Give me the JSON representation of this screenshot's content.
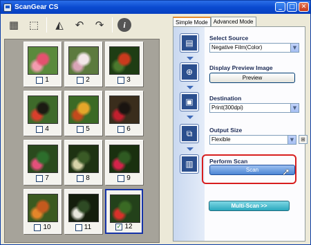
{
  "window": {
    "title": "ScanGear CS"
  },
  "toolbar": {
    "icons": [
      "thumbnail-view-icon",
      "crop-icon",
      "mirror-icon",
      "rotate-left-icon",
      "rotate-right-icon",
      "info-icon"
    ]
  },
  "thumbnails": [
    {
      "number": "1",
      "checked": false,
      "colors": [
        "#e4516f",
        "#f29bae",
        "#5a8a3c"
      ]
    },
    {
      "number": "2",
      "checked": false,
      "colors": [
        "#f3e7ea",
        "#d8a4b6",
        "#5c7a3e"
      ]
    },
    {
      "number": "3",
      "checked": false,
      "colors": [
        "#c93a1d",
        "#4b7a2e",
        "#1e3d14"
      ]
    },
    {
      "number": "4",
      "checked": false,
      "colors": [
        "#1b1b12",
        "#d83f2c",
        "#3e6a2a"
      ]
    },
    {
      "number": "5",
      "checked": false,
      "colors": [
        "#e5a62a",
        "#c24a1c",
        "#3b6a25"
      ]
    },
    {
      "number": "6",
      "checked": false,
      "colors": [
        "#1a1410",
        "#c21f2e",
        "#3a2d1c"
      ]
    },
    {
      "number": "7",
      "checked": false,
      "colors": [
        "#2d6e2c",
        "#e3507a",
        "#2a4a1d"
      ]
    },
    {
      "number": "8",
      "checked": false,
      "colors": [
        "#3a5a26",
        "#d6d2a8",
        "#1e3212"
      ]
    },
    {
      "number": "9",
      "checked": false,
      "colors": [
        "#2f5a22",
        "#d3234a",
        "#19300f"
      ]
    },
    {
      "number": "10",
      "checked": false,
      "colors": [
        "#c45a1e",
        "#e4862a",
        "#3b5a1f"
      ]
    },
    {
      "number": "11",
      "checked": false,
      "colors": [
        "#2e4a24",
        "#e6e6dc",
        "#141e0c"
      ]
    },
    {
      "number": "12",
      "checked": true,
      "colors": [
        "#3a6a24",
        "#d8312a",
        "#23411a"
      ]
    }
  ],
  "tabs": {
    "simple": "Simple Mode",
    "advanced": "Advanced Mode"
  },
  "steps": {
    "select_source": {
      "label": "Select Source",
      "value": "Negative Film(Color)"
    },
    "preview": {
      "label": "Display Preview Image",
      "button": "Preview"
    },
    "destination": {
      "label": "Destination",
      "value": "Print(300dpi)"
    },
    "output_size": {
      "label": "Output Size",
      "value": "Flexible"
    },
    "perform_scan": {
      "label": "Perform Scan",
      "button": "Scan"
    }
  },
  "multi_scan": {
    "label": "Multi-Scan >>"
  },
  "colors": {
    "accent": "#0a4ad0",
    "highlight": "#d81e1e",
    "panel_bg": "#ece9d8"
  }
}
